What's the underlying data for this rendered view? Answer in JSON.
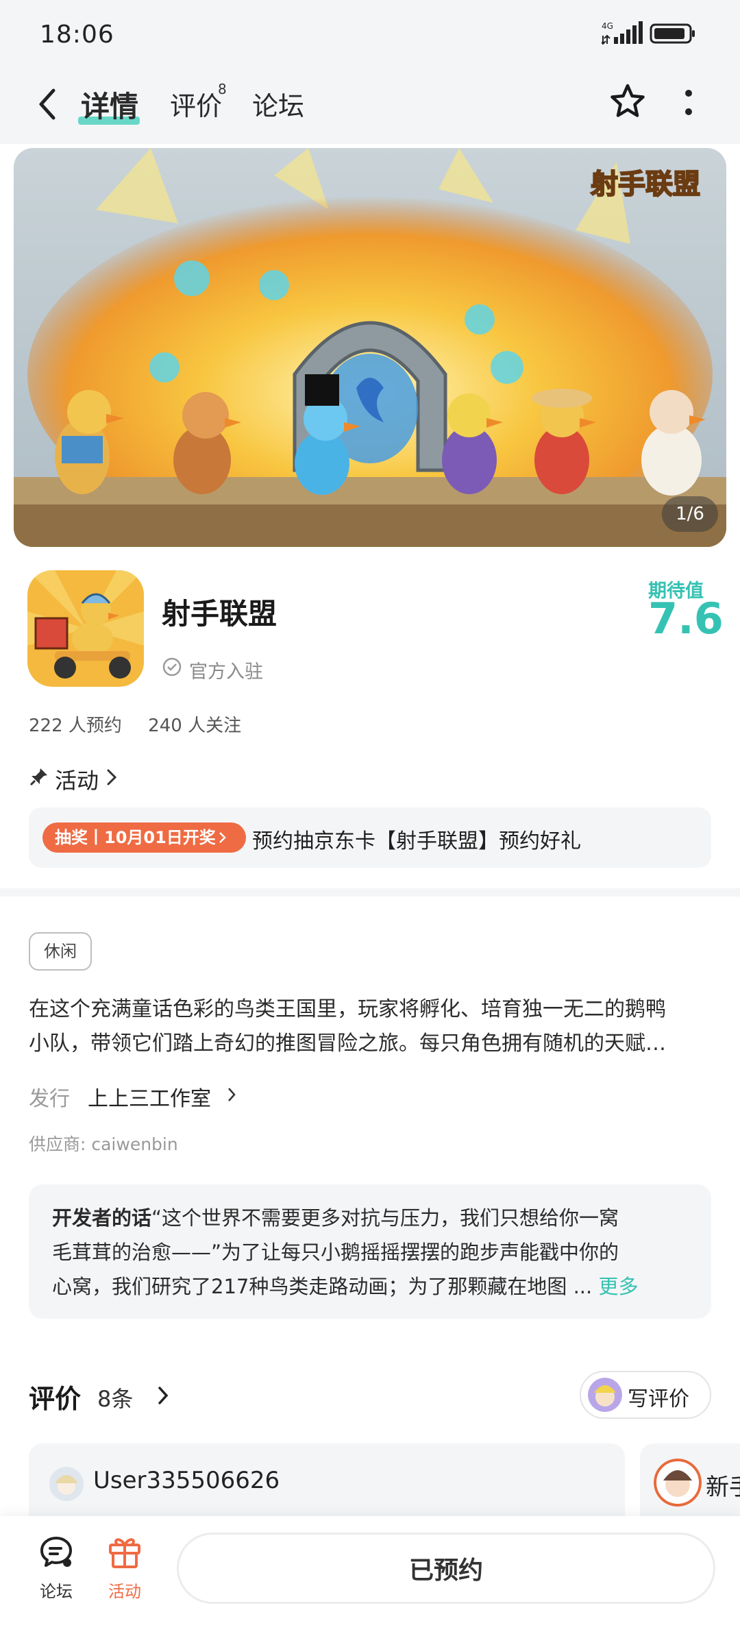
{
  "status_bar": {
    "time": "18:06",
    "network": "4G"
  },
  "header": {
    "tabs": [
      {
        "label": "详情"
      },
      {
        "label": "评价",
        "badge": "8"
      },
      {
        "label": "论坛"
      }
    ]
  },
  "banner": {
    "logo_text": "射手联盟",
    "counter": "1/6"
  },
  "app": {
    "name": "射手联盟",
    "verified": "官方入驻",
    "expect_label": "期待值",
    "expect_value": "7.6",
    "reservations": "222 人预约",
    "followers": "240 人关注"
  },
  "activity": {
    "label": "活动",
    "badge": "抽奖丨10月01日开奖",
    "text": "预约抽京东卡【射手联盟】预约好礼"
  },
  "details": {
    "tag": "休闲",
    "desc_line1": "在这个充满童话色彩的鸟类王国里，玩家将孵化、培育独一无二的鹅鸭",
    "desc_line2": "小队，带领它们踏上奇幻的推图冒险之旅。每只角色拥有随机的天赋…",
    "publisher_label": "发行",
    "publisher": "上上三工作室",
    "supplier": "供应商: caiwenbin"
  },
  "developer": {
    "title": "开发者的话",
    "line1": "“这个世界不需要更多对抗与压力，我们只想给你一窝",
    "line2": "毛茸茸的治愈——”为了让每只小鹅摇摇摆摆的跑步声能戳中你的",
    "line3": "心窝，我们研究了217种鸟类走路动画；为了那颗藏在地图 ...",
    "more": "更多"
  },
  "reviews": {
    "title": "评价",
    "count": "8条",
    "write_label": "写评价",
    "cards": [
      {
        "user": "User335506626"
      },
      {
        "user": "新手"
      }
    ]
  },
  "bottom_nav": {
    "forum_label": "论坛",
    "activity_label": "活动",
    "reserved_label": "已预约"
  },
  "colors": {
    "accent": "#35c2b3",
    "promo": "#ef6b43",
    "bg_gray": "#f4f5f7"
  }
}
